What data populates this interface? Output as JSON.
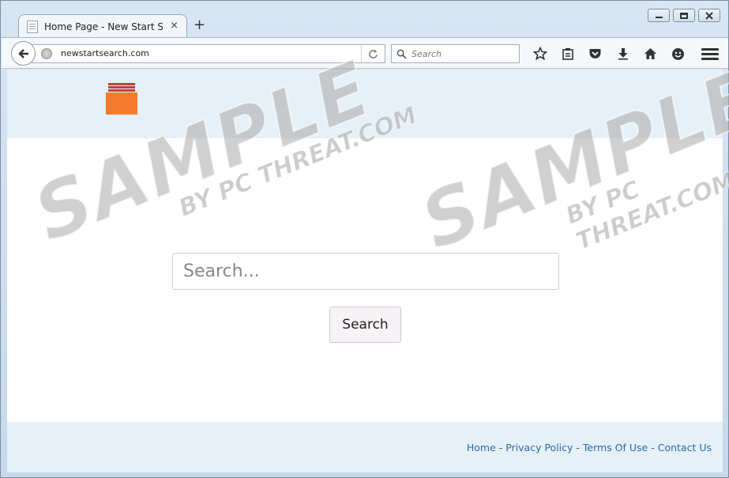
{
  "tab": {
    "title": "Home Page - New Start Se...",
    "close": "×"
  },
  "new_tab": "+",
  "url": "newstartsearch.com",
  "browser_search": {
    "placeholder": "Search"
  },
  "page": {
    "search_placeholder": "Search...",
    "search_button": "Search"
  },
  "footer": {
    "links": [
      "Home",
      "Privacy Policy",
      "Terms Of Use",
      "Contact Us"
    ],
    "separator": " - "
  },
  "watermark": {
    "main": "SAMPLE",
    "sub": "BY PC THREAT.COM"
  },
  "colors": {
    "logo": "#f47b2e",
    "link": "#2a6aa0",
    "header_bg": "#e6f0f7"
  }
}
